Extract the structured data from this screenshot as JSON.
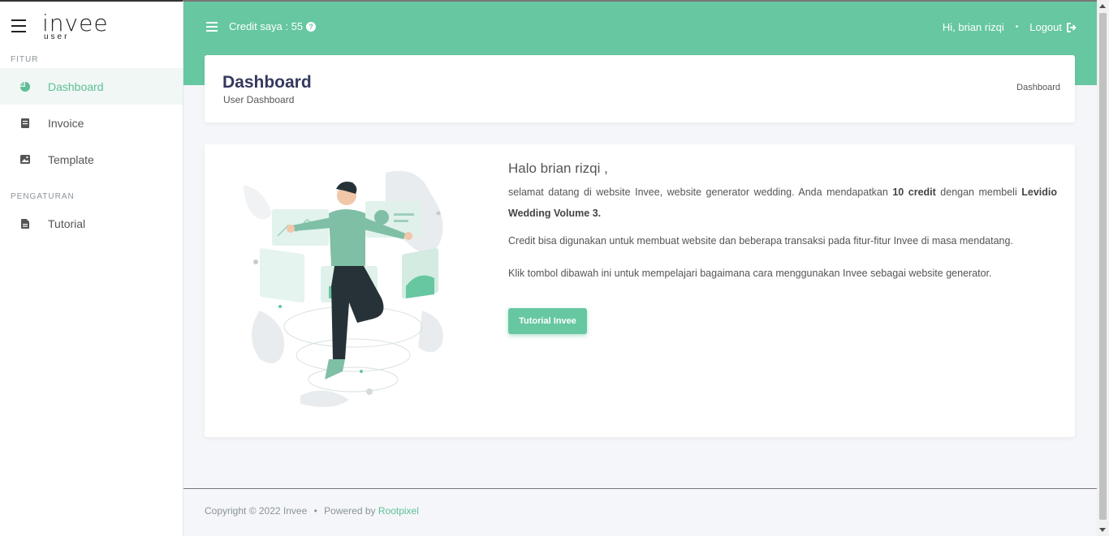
{
  "brand": {
    "name": "invee",
    "sub": "user"
  },
  "sidebar": {
    "sections": [
      {
        "label": "FITUR"
      },
      {
        "label": "PENGATURAN"
      }
    ],
    "items": [
      {
        "label": "Dashboard",
        "icon": "chart-pie-icon",
        "active": true
      },
      {
        "label": "Invoice",
        "icon": "receipt-icon"
      },
      {
        "label": "Template",
        "icon": "image-icon"
      },
      {
        "label": "Tutorial",
        "icon": "file-icon"
      }
    ]
  },
  "topbar": {
    "credit_label": "Credit saya : 55",
    "greeting": "Hi, brian rizqi",
    "separator": "•",
    "logout": "Logout"
  },
  "header": {
    "title": "Dashboard",
    "subtitle": "User Dashboard",
    "breadcrumb": "Dashboard"
  },
  "main": {
    "greeting": "Halo brian rizqi ,",
    "p1_a": "selamat datang di website Invee, website generator wedding. Anda mendapatkan ",
    "p1_b": "10 credit",
    "p1_c": " dengan membeli ",
    "p1_d": "Levidio Wedding Volume 3.",
    "p2": "Credit bisa digunakan untuk membuat website dan beberapa transaksi pada fitur-fitur Invee di masa mendatang.",
    "p3": "Klik tombol dibawah ini untuk mempelajari bagaimana cara menggunakan Invee sebagai website generator.",
    "button": "Tutorial Invee"
  },
  "footer": {
    "text": "Copyright © 2022 Invee",
    "separator": "•",
    "powered": "Powered by ",
    "link": "Rootpixel"
  },
  "colors": {
    "accent": "#66c7a1",
    "title": "#34395e"
  }
}
